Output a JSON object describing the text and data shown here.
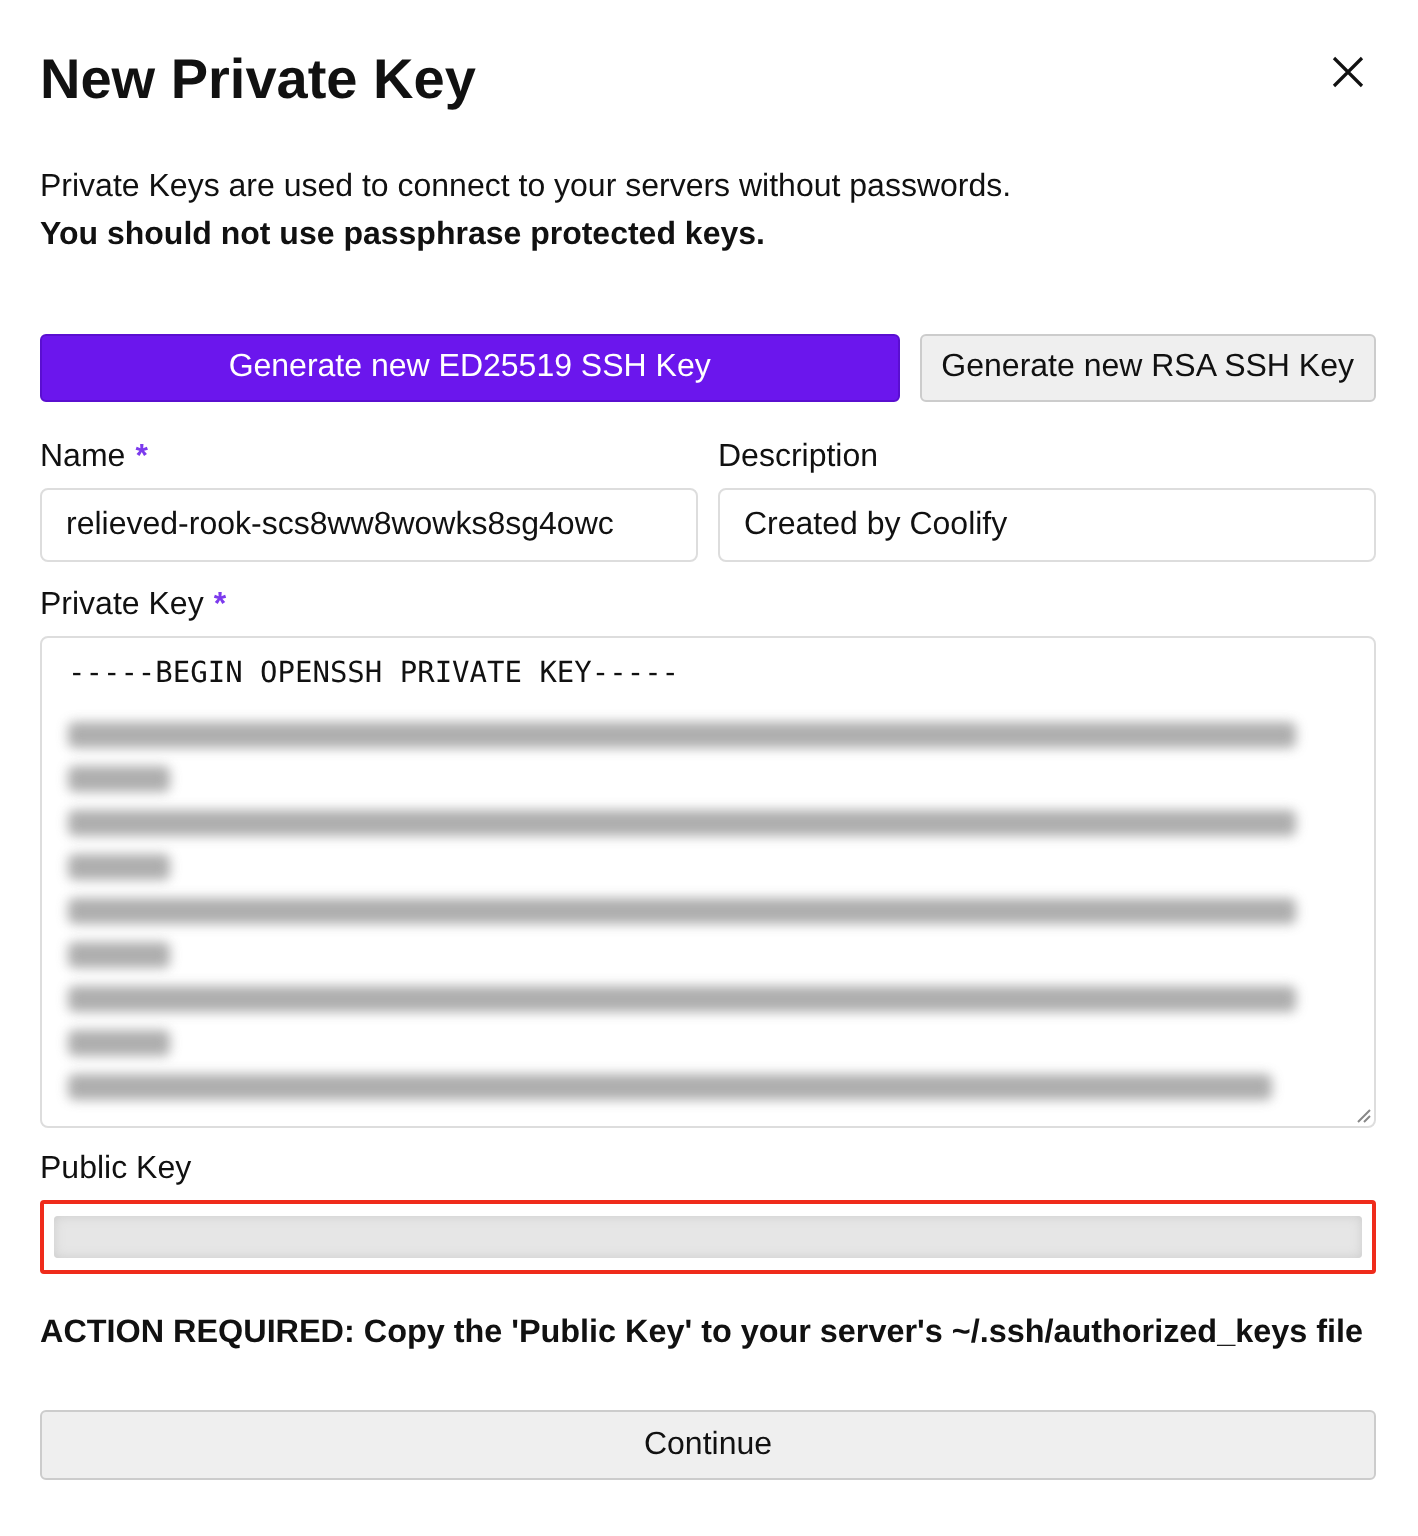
{
  "title": "New Private Key",
  "intro": "Private Keys are used to connect to your servers without passwords.",
  "warning": "You should not use passphrase protected keys.",
  "generate_buttons": [
    {
      "label": "Generate new ED25519 SSH Key",
      "kind": "primary"
    },
    {
      "label": "Generate new RSA SSH Key",
      "kind": "secondary"
    }
  ],
  "fields": [
    {
      "label": "Name",
      "required_mark": "*",
      "value": "relieved-rook-scs8ww8wowks8sg4owc"
    },
    {
      "label": "Description",
      "value": "Created by Coolify"
    }
  ],
  "private_key": {
    "label": "Private Key",
    "required_mark": "*",
    "first_line": "-----BEGIN OPENSSH PRIVATE KEY-----"
  },
  "public_key": {
    "label": "Public Key",
    "highlighted": true
  },
  "notice": "ACTION REQUIRED: Copy the 'Public Key' to your server's ~/.ssh/authorized_keys file",
  "continue_button": "Continue"
}
